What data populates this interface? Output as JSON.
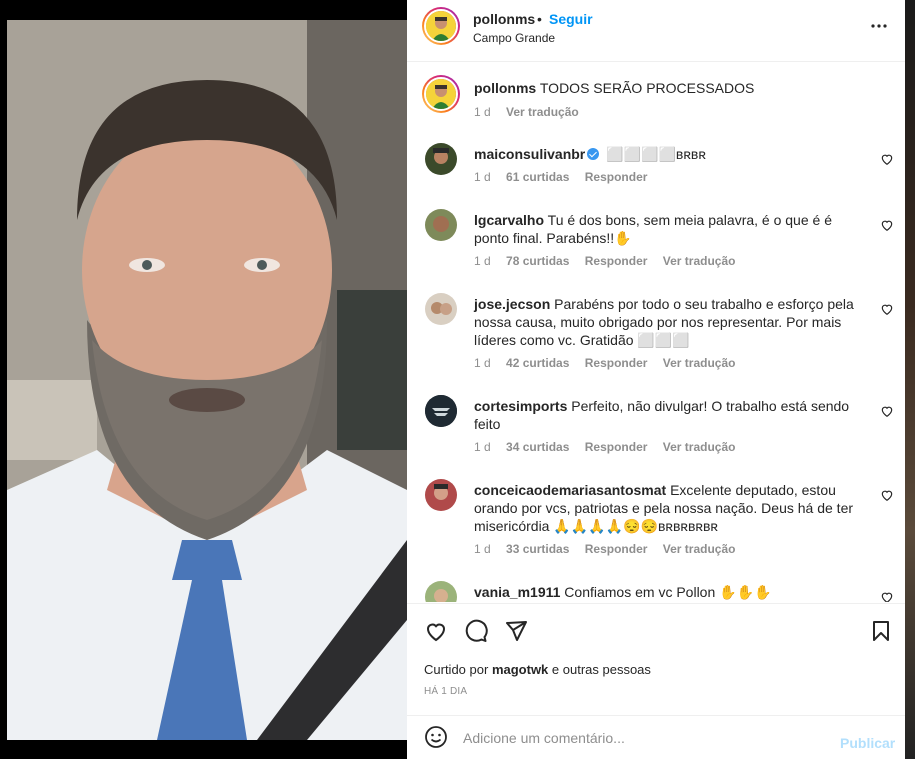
{
  "post": {
    "username": "pollonms",
    "dot": "•",
    "follow_label": "Seguir",
    "location": "Campo Grande",
    "caption": "TODOS SERÃO PROCESSADOS",
    "caption_age": "1 d",
    "caption_translate": "Ver tradução"
  },
  "comments": [
    {
      "username": "maiconsulivanbr",
      "verified": true,
      "text": "⬜⬜⬜⬜ʙʀʙʀ",
      "age": "1 d",
      "likes": "61 curtidas",
      "reply": "Responder",
      "translate": ""
    },
    {
      "username": "lgcarvalho",
      "verified": false,
      "text": "Tu é dos bons, sem meia palavra, é o que é é ponto final. Parabéns!!✋",
      "age": "1 d",
      "likes": "78 curtidas",
      "reply": "Responder",
      "translate": "Ver tradução"
    },
    {
      "username": "jose.jecson",
      "verified": false,
      "text": "Parabéns por todo o seu trabalho e esforço pela nossa causa, muito obrigado por nos representar. Por mais líderes como vc. Gratidão ⬜⬜⬜",
      "age": "1 d",
      "likes": "42 curtidas",
      "reply": "Responder",
      "translate": "Ver tradução"
    },
    {
      "username": "cortesimports",
      "verified": false,
      "text": "Perfeito, não divulgar! O trabalho está sendo feito",
      "age": "1 d",
      "likes": "34 curtidas",
      "reply": "Responder",
      "translate": "Ver tradução"
    },
    {
      "username": "conceicaodemariasantosmat",
      "verified": false,
      "text": "Excelente deputado, estou orando por vcs, patriotas e pela nossa nação. Deus há de ter misericórdia 🙏🙏🙏🙏😔😔ʙʀʙʀʙʀʙʀ",
      "age": "1 d",
      "likes": "33 curtidas",
      "reply": "Responder",
      "translate": "Ver tradução"
    },
    {
      "username": "vania_m1911",
      "verified": false,
      "text": "Confiamos em vc Pollon ✋✋✋",
      "age": "",
      "likes": "",
      "reply": "",
      "translate": ""
    }
  ],
  "footer": {
    "liked_prefix": "Curtido por",
    "liked_user": "magotwk",
    "liked_suffix": "e outras pessoas",
    "time": "HÁ 1 DIA",
    "comment_placeholder": "Adicione um comentário...",
    "post_label": "Publicar"
  },
  "colors": {
    "accent": "#0095f6",
    "text": "#262626",
    "muted": "#8e8e8e",
    "post_disabled": "#b2dffc"
  },
  "icons": [
    "more-icon",
    "heart-icon",
    "comment-icon",
    "share-icon",
    "bookmark-icon",
    "emoji-icon",
    "verified-icon"
  ]
}
